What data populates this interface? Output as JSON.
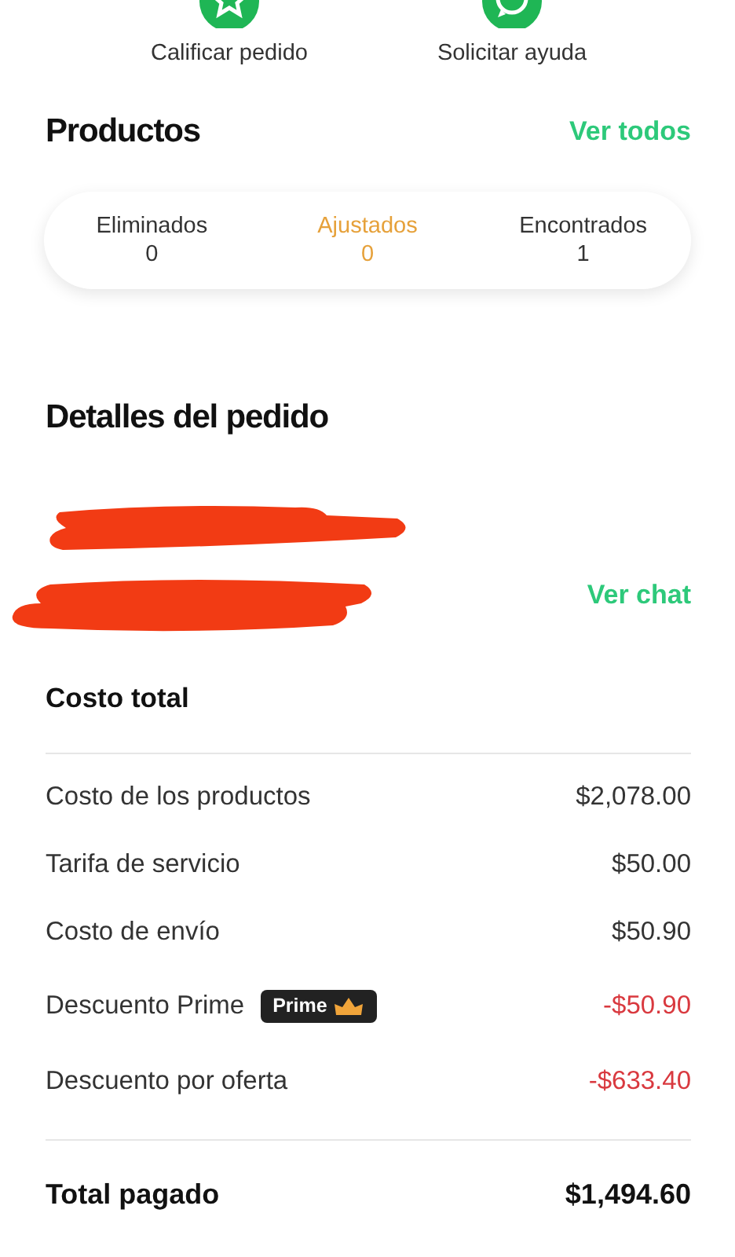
{
  "actions": [
    {
      "label": "Calificar pedido",
      "kind": "rate"
    },
    {
      "label": "Solicitar ayuda",
      "kind": "help"
    }
  ],
  "products": {
    "title": "Productos",
    "link": "Ver todos",
    "counts": [
      {
        "label": "Eliminados",
        "value": "0",
        "selected": false
      },
      {
        "label": "Ajustados",
        "value": "0",
        "selected": true
      },
      {
        "label": "Encontrados",
        "value": "1",
        "selected": false
      }
    ]
  },
  "order_details": {
    "title": "Detalles del pedido",
    "lines": [
      {
        "kind": "redacted"
      },
      {
        "kind": "redacted"
      }
    ],
    "chat_link": "Ver chat"
  },
  "cost": {
    "title": "Costo total",
    "rows": [
      {
        "label": "Costo de los productos",
        "amount": "$2,078.00",
        "kind": "charge"
      },
      {
        "label": "Tarifa de servicio",
        "amount": "$50.00",
        "kind": "charge"
      },
      {
        "label": "Costo de envío",
        "amount": "$50.90",
        "kind": "charge"
      },
      {
        "label": "Descuento Prime",
        "badge": "Prime",
        "amount": "-$50.90",
        "kind": "discount"
      },
      {
        "label": "Descuento por oferta",
        "amount": "-$633.40",
        "kind": "discount"
      }
    ],
    "total_label": "Total pagado",
    "total": "$1,494.60"
  }
}
